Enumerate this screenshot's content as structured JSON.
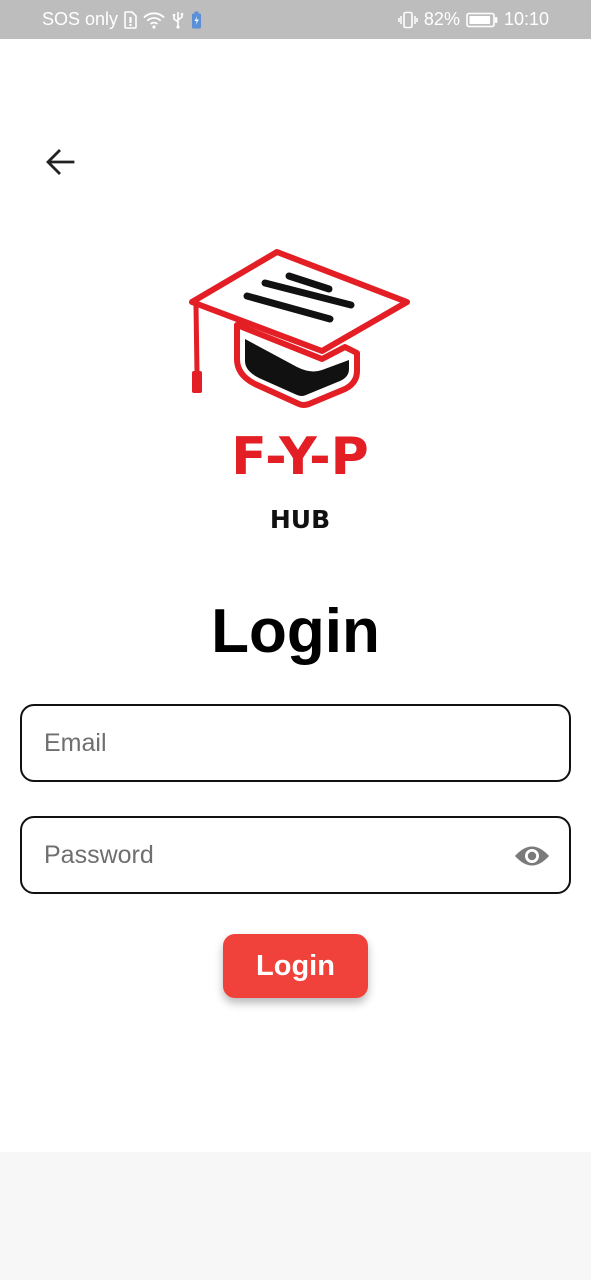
{
  "status_bar": {
    "carrier": "SOS only",
    "battery_percent": "82%",
    "time": "10:10"
  },
  "icons": {
    "back": "arrow-left-icon",
    "eye": "eye-icon"
  },
  "logo": {
    "title": "F-Y-P",
    "subtitle": "HUB",
    "accent_color": "#e31e24"
  },
  "page": {
    "title": "Login"
  },
  "form": {
    "email_placeholder": "Email",
    "password_placeholder": "Password",
    "submit_label": "Login"
  },
  "colors": {
    "status_bar": "#bdbdbd",
    "button": "#f0413a",
    "bottom_area": "#f7f7f7"
  }
}
